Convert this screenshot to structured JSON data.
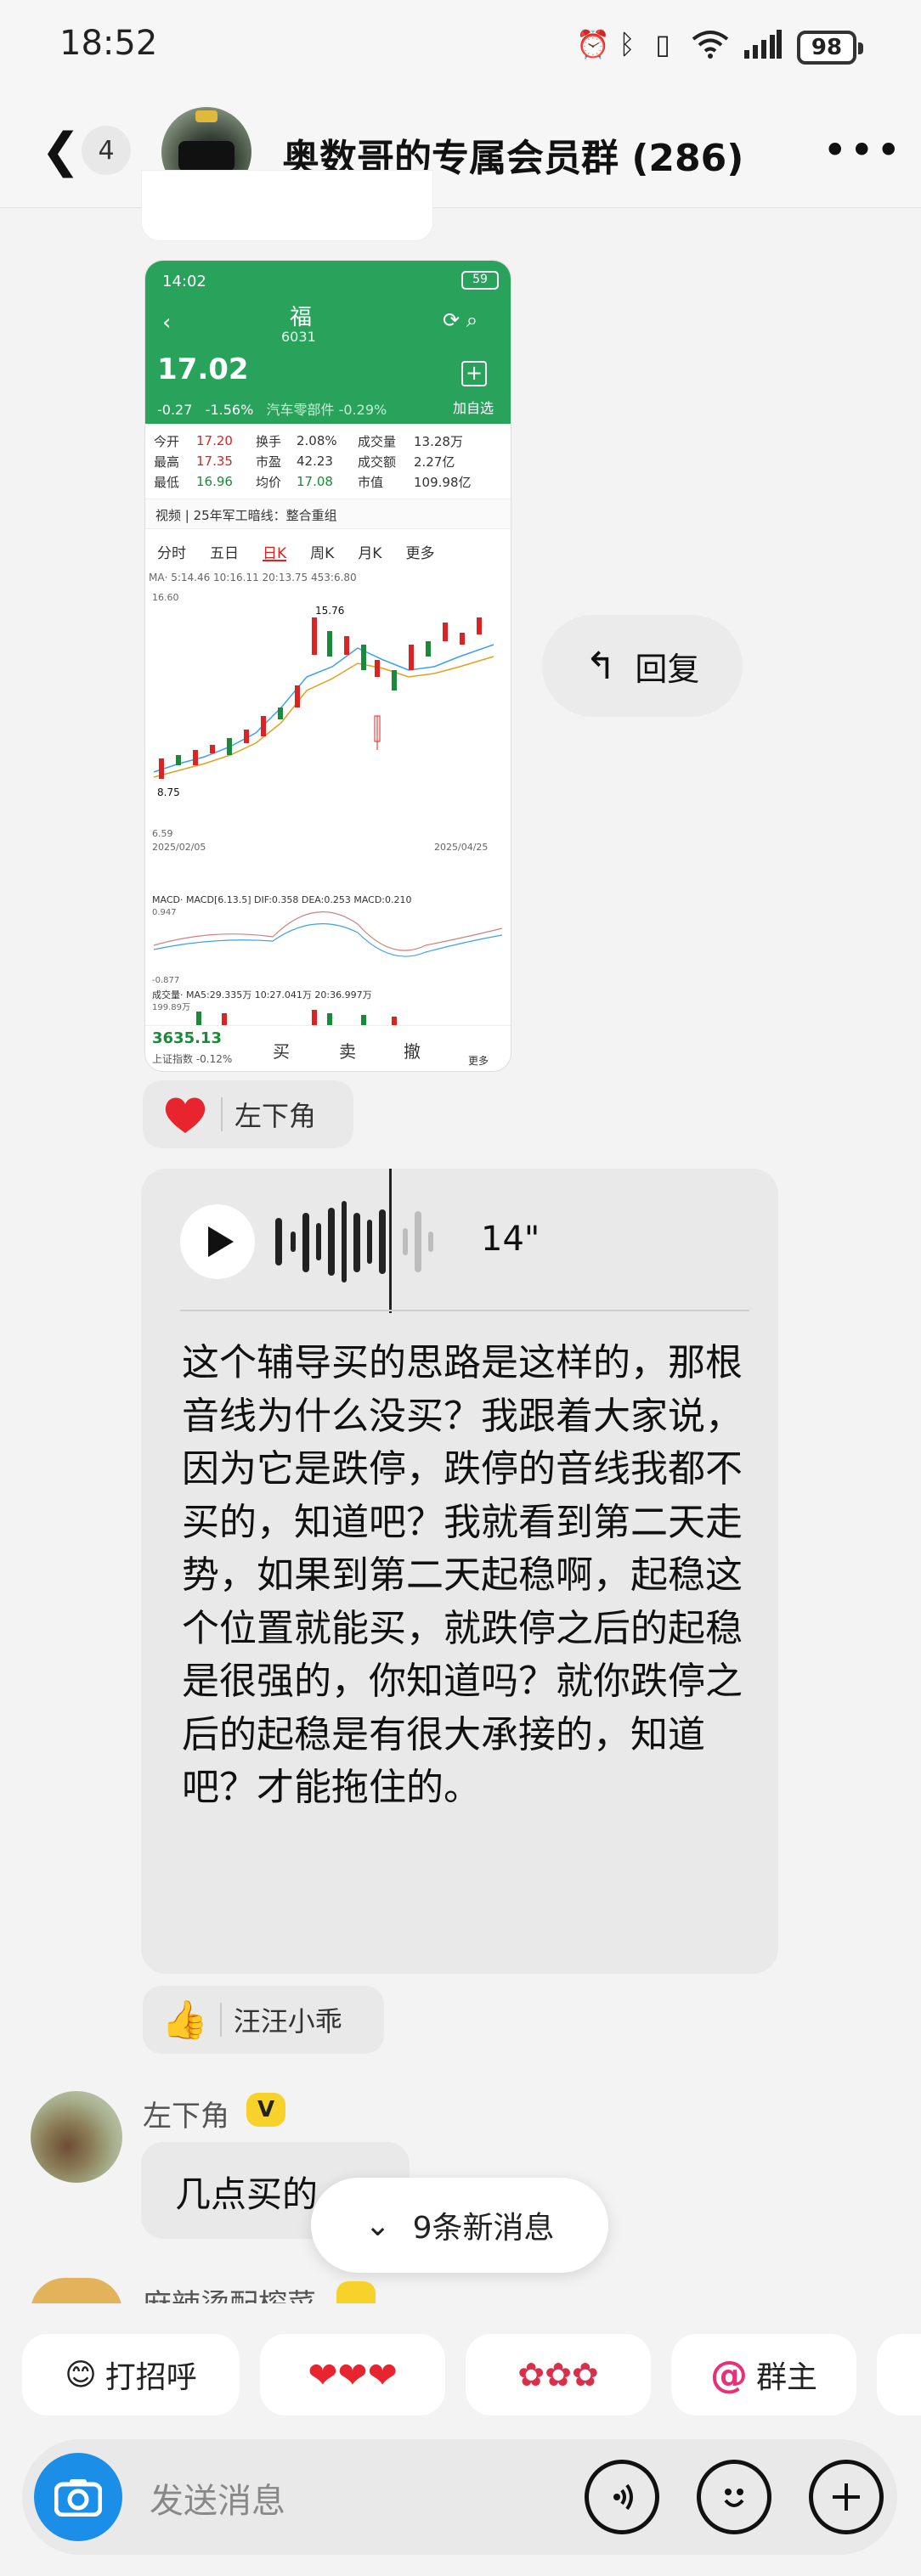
{
  "status_bar": {
    "time": "18:52",
    "battery": "98",
    "icons": [
      "alarm-icon",
      "bluetooth-icon",
      "vibrate-icon",
      "wifi-icon",
      "signal-icon"
    ]
  },
  "header": {
    "unread_count": "4",
    "group_title": "奥数哥的专属会员群 (286)"
  },
  "stock_screenshot": {
    "time": "14:02",
    "battery": "59",
    "name": "福",
    "code": "6031",
    "price": "17.02",
    "change": "-0.27",
    "change_pct": "-1.56%",
    "sector": "汽车零部件 -0.29%",
    "add_label": "加自选",
    "stats": [
      [
        "今开",
        "17.20",
        "换手",
        "2.08%",
        "成交量",
        "13.28万"
      ],
      [
        "最高",
        "17.35",
        "市盈",
        "42.23",
        "成交额",
        "2.27亿"
      ],
      [
        "最低",
        "16.96",
        "均价",
        "17.08",
        "市值",
        "109.98亿"
      ]
    ],
    "video_bar": "视频 | 25年军工暗线：整合重组",
    "tabs": [
      "分时",
      "五日",
      "日K",
      "周K",
      "月K",
      "更多"
    ],
    "ma_line": "MA· 5:14.46  10:16.11  20:13.75  453:6.80",
    "high_label": "15.76",
    "low_label": "8.75",
    "top_axis": "16.60",
    "bottom_axis": "6.59",
    "date_start": "2025/02/05",
    "date_end": "2025/04/25",
    "macd_line": "MACD· MACD[6.13.5] DIF:0.358  DEA:0.253  MACD:0.210",
    "macd_top": "0.947",
    "macd_bottom": "-0.877",
    "vol_line": "成交量· MA5:29.335万  10:27.041万  20:36.997万",
    "vol_top": "199.89万",
    "index_value": "3635.13",
    "index_label": "上证指数 -0.12%",
    "actions": [
      "买",
      "卖",
      "撤",
      "更多"
    ]
  },
  "reply_button": {
    "label": "回复"
  },
  "reaction_1": {
    "name": "左下角"
  },
  "voice_message": {
    "duration": "14\"",
    "transcript": "这个辅导买的思路是这样的，那根音线为什么没买？我跟着大家说，因为它是跌停，跌停的音线我都不买的，知道吧？我就看到第二天走势，如果到第二天起稳啊，起稳这个位置就能买，就跌停之后的起稳是很强的，你知道吗？就你跌停之后的起稳是有很大承接的，知道吧？才能拖住的。"
  },
  "reaction_2": {
    "name": "汪汪小乖"
  },
  "message_2": {
    "sender": "左下角",
    "badge": "V",
    "text": "几点买的"
  },
  "new_messages": {
    "label": "9条新消息"
  },
  "message_3": {
    "sender": "麻辣烫配榨菜",
    "badge": "V"
  },
  "quick_replies": [
    {
      "icon": "wave-emoji",
      "label": "打招呼"
    },
    {
      "icon": "hearts-emoji",
      "label": ""
    },
    {
      "icon": "roses-emoji",
      "label": ""
    },
    {
      "icon": "at-icon",
      "label": "群主"
    }
  ],
  "input": {
    "placeholder": "发送消息"
  },
  "colors": {
    "stock_green": "#29a35c",
    "camera_blue": "#1b8fe8",
    "vip_yellow": "#f6d22a",
    "heart_red": "#e8242f"
  }
}
